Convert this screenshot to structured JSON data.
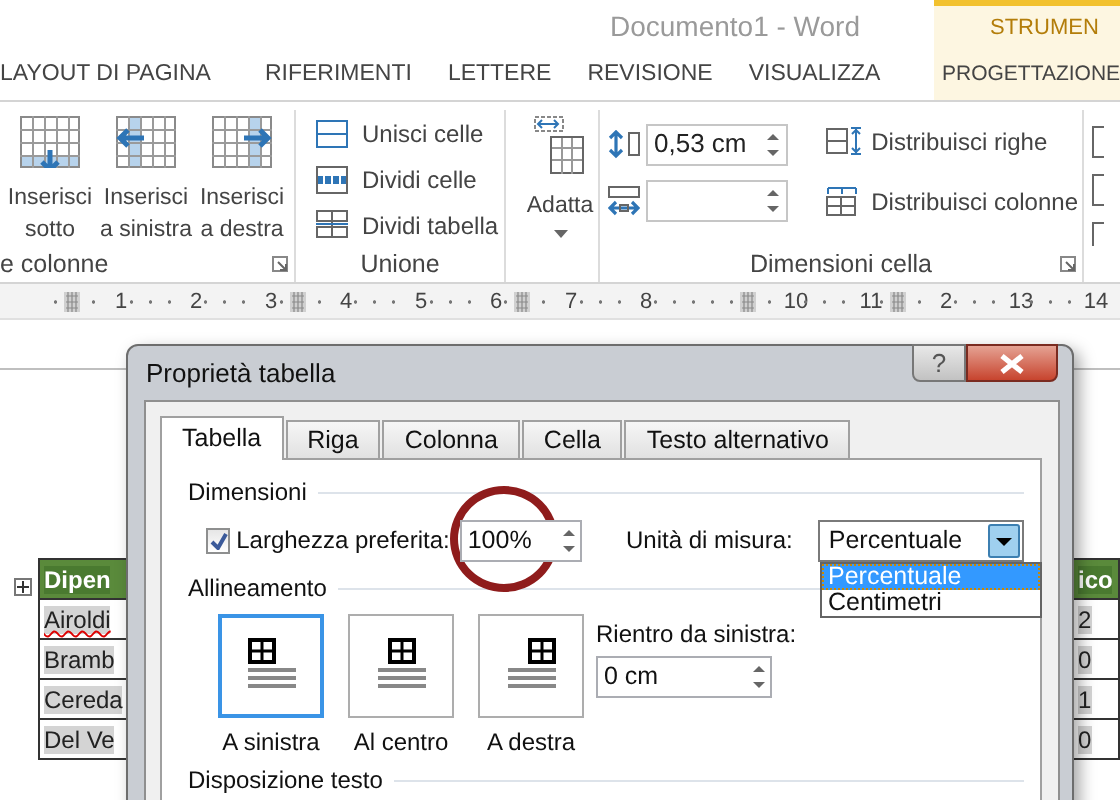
{
  "window": {
    "title": "Documento1 - Word"
  },
  "ribbon_tabs": [
    {
      "label": "LAYOUT DI PAGINA"
    },
    {
      "label": "RIFERIMENTI"
    },
    {
      "label": "LETTERE"
    },
    {
      "label": "REVISIONE"
    },
    {
      "label": "VISUALIZZA"
    }
  ],
  "contextual_tabs": {
    "title": "STRUMEN",
    "tabs": [
      {
        "label": "PROGETTAZIONE"
      }
    ]
  },
  "ribbon_groups": [
    {
      "label": "e colonne",
      "launcher": true,
      "items": [
        {
          "kind": "large",
          "lines": [
            "Inserisci",
            "sotto"
          ]
        },
        {
          "kind": "large",
          "lines": [
            "Inserisci",
            "a sinistra"
          ]
        },
        {
          "kind": "large",
          "lines": [
            "Inserisci",
            "a destra"
          ]
        }
      ]
    },
    {
      "label": "Unione",
      "items": [
        {
          "kind": "small",
          "label": "Unisci celle"
        },
        {
          "kind": "small",
          "label": "Dividi celle"
        },
        {
          "kind": "small",
          "label": "Dividi tabella"
        }
      ]
    },
    {
      "items": [
        {
          "kind": "dropdown",
          "label": "Adatta"
        }
      ]
    },
    {
      "label": "Dimensioni cella",
      "launcher": true,
      "items": [
        {
          "kind": "spin",
          "value": "0,53 cm"
        },
        {
          "kind": "spin"
        },
        {
          "kind": "small",
          "label": "Distribuisci righe"
        },
        {
          "kind": "small",
          "label": "Distribuisci colonne"
        }
      ]
    },
    {
      "items": [
        {
          "kind": "icon"
        },
        {
          "kind": "icon"
        },
        {
          "kind": "icon"
        }
      ]
    }
  ],
  "ruler": {
    "items": [
      {
        "kind": "marker"
      },
      {
        "kind": "number",
        "label": "1"
      },
      {
        "kind": "number",
        "label": "2"
      },
      {
        "kind": "number",
        "label": "3"
      },
      {
        "kind": "marker"
      },
      {
        "kind": "number",
        "label": "4"
      },
      {
        "kind": "number",
        "label": "5"
      },
      {
        "kind": "number",
        "label": "6"
      },
      {
        "kind": "marker"
      },
      {
        "kind": "number",
        "label": "7"
      },
      {
        "kind": "number",
        "label": "8"
      },
      {
        "kind": "blank"
      },
      {
        "kind": "marker"
      },
      {
        "kind": "number",
        "label": "10"
      },
      {
        "kind": "number",
        "label": "11"
      },
      {
        "kind": "marker"
      },
      {
        "kind": "number",
        "label": "2"
      },
      {
        "kind": "number",
        "label": "13"
      },
      {
        "kind": "number",
        "label": "14"
      }
    ]
  },
  "document": {
    "table": {
      "header": {
        "column_1": "Dipen",
        "column_2": "ico"
      },
      "rows": [
        {
          "column_1": "Airoldi",
          "column_1_misspelled": true,
          "column_2": "2"
        },
        {
          "column_1": "Bramb",
          "column_2": "0"
        },
        {
          "column_1": "Cereda",
          "column_2": "1"
        },
        {
          "column_1": "Del Ve",
          "column_2": "0"
        }
      ]
    }
  },
  "dialog": {
    "title": "Proprietà tabella",
    "title_buttons": [
      {
        "kind": "help",
        "label": "?"
      },
      {
        "kind": "close"
      }
    ],
    "tabs": [
      {
        "label": "Tabella",
        "selected": true
      },
      {
        "label": "Riga",
        "selected": false
      },
      {
        "label": "Colonna",
        "selected": false
      },
      {
        "label": "Cella",
        "selected": false
      },
      {
        "label": "Testo alternativo",
        "selected": false
      }
    ],
    "dimensions": {
      "heading": "Dimensioni",
      "preferred_width": {
        "label": "Larghezza preferita:",
        "checked": true,
        "value": "100%"
      },
      "unit": {
        "label": "Unità di misura:",
        "value": "Percentuale",
        "expanded": true,
        "options": [
          {
            "label": "Percentuale",
            "selected": true
          },
          {
            "label": "Centimetri",
            "selected": false
          }
        ]
      }
    },
    "alignment": {
      "heading": "Allineamento",
      "options": [
        {
          "label": "A sinistra",
          "selected": true
        },
        {
          "label": "Al centro",
          "selected": false
        },
        {
          "label": "A destra",
          "selected": false
        }
      ],
      "indent": {
        "label": "Rientro da sinistra:",
        "value": "0 cm"
      }
    },
    "text_wrapping": {
      "heading": "Disposizione testo"
    }
  },
  "annotations": [
    {
      "kind": "circle"
    }
  ]
}
